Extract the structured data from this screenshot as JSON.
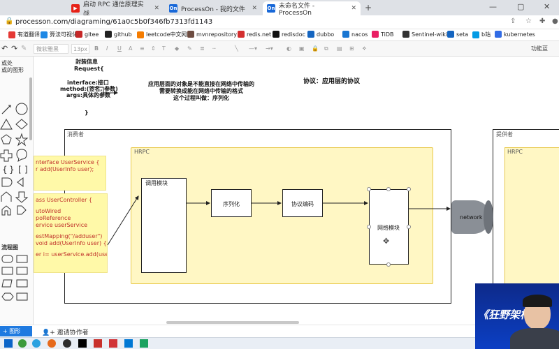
{
  "browser": {
    "tabs": [
      {
        "label": "启动 RPC 通信原理实战",
        "icon": "youtube-icon",
        "active": false
      },
      {
        "label": "ProcessOn - 我的文件",
        "icon": "processon-icon",
        "active": false
      },
      {
        "label": "未命名文件 - ProcessOn",
        "icon": "processon-icon",
        "active": true
      }
    ],
    "new_tab": "+",
    "url": "processon.com/diagraming/61a0c5b0f346fb7313fd1143",
    "bookmarks": [
      "有道翻译",
      "算法可视化",
      "gitee",
      "github",
      "leetcode中文网",
      "mvnrepository",
      "redis.net",
      "redisdoc",
      "dubbo",
      "nacos",
      "TiDB",
      "Sentinel-wiki",
      "seta",
      "b站",
      "kubernetes"
    ]
  },
  "toolbar": {
    "style_select": "微软雅黑",
    "font_size": "13px",
    "bold": "B",
    "italic": "I",
    "underline": "U",
    "font_color": "A",
    "text_style": "T",
    "right_label": "功能蓝"
  },
  "left_panel": {
    "header_line1": "或处",
    "header_line2": "或的图形",
    "section_flow": "流程图"
  },
  "diagram": {
    "rpc_info": {
      "line1": "封装信息",
      "line2": "Request{",
      "line3": "interface:接口",
      "line4": "method:(签名, 参数)",
      "line5": "args:具体的参数",
      "line6": "}"
    },
    "note": {
      "line1": "应用层面的对象是不能直接在网络中传输的",
      "line2": "需要转换成能在网络中传输的格式",
      "line3": "这个过程叫做：序列化"
    },
    "protocol_title": "协议：应用层的协议",
    "consumer": "消费者",
    "provider": "提供者",
    "hrpc_left": "HRPC",
    "hrpc_right": "HRPC",
    "call_module": "调用模块",
    "serialize": "序列化",
    "protocol_encode": "协议编码",
    "network_module": "网络模块",
    "network": "network",
    "sticky1": {
      "line1": "nterface UserService {",
      "line2": "r add(UserInfo user);"
    },
    "sticky2": {
      "line1": "ass UserController {",
      "line2": "utoWired",
      "line3": "poReference",
      "line4": "ervice userService",
      "line5": "estMapping(\"/adduser\")",
      "line6": "void add(UserInfo user) {",
      "line7": "er i= userService.add(user);"
    }
  },
  "bottom": {
    "left_button": "图形",
    "invite": "邀请协作者"
  },
  "webcam": {
    "caption": "《狂野架构"
  },
  "colors": {
    "hrpc_fill": "#fff7c4",
    "hrpc_border": "#e8c84a",
    "sticky_fill": "#fff9a8",
    "code_text": "#c0312b",
    "network_fill": "#8a8f96"
  }
}
